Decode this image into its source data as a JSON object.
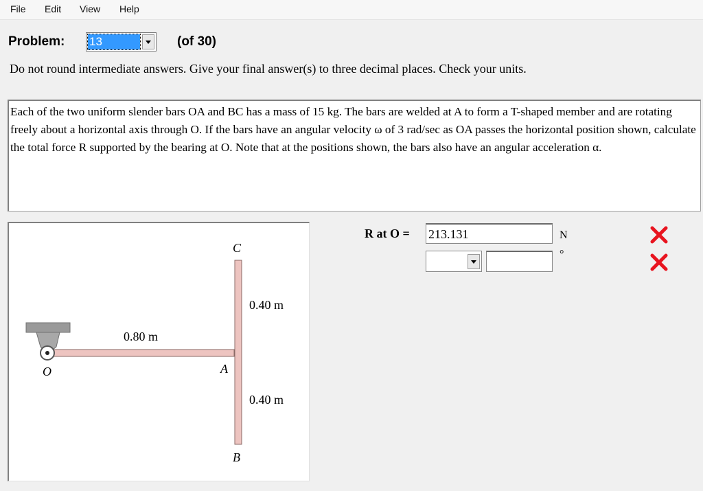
{
  "menu": {
    "items": [
      "File",
      "Edit",
      "View",
      "Help"
    ]
  },
  "problem": {
    "label": "Problem:",
    "selected": "13",
    "of_text": "(of 30)"
  },
  "instructions": "Do not round intermediate answers. Give your final answer(s) to three decimal places. Check your units.",
  "problem_text": "Each of the two uniform slender bars OA and BC has a mass of 15 kg. The bars are welded at A to form a T-shaped member and are rotating freely about a horizontal axis through O. If the bars have an angular velocity ω of 3 rad/sec as OA passes the horizontal position shown, calculate the total force R supported by the bearing at O. Note that at the positions shown, the bars also have an angular acceleration α.",
  "figure": {
    "label_C": "C",
    "label_B": "B",
    "label_A": "A",
    "label_O": "O",
    "dim_OA": "0.80 m",
    "dim_AC": "0.40 m",
    "dim_AB": "0.40 m"
  },
  "answer": {
    "label": "R at O =",
    "value": "213.131",
    "unit": "N",
    "direction_value": "",
    "angle_value": "",
    "angle_unit": "°",
    "status_icon": "incorrect-x-icon",
    "status_color": "#e8141f"
  }
}
